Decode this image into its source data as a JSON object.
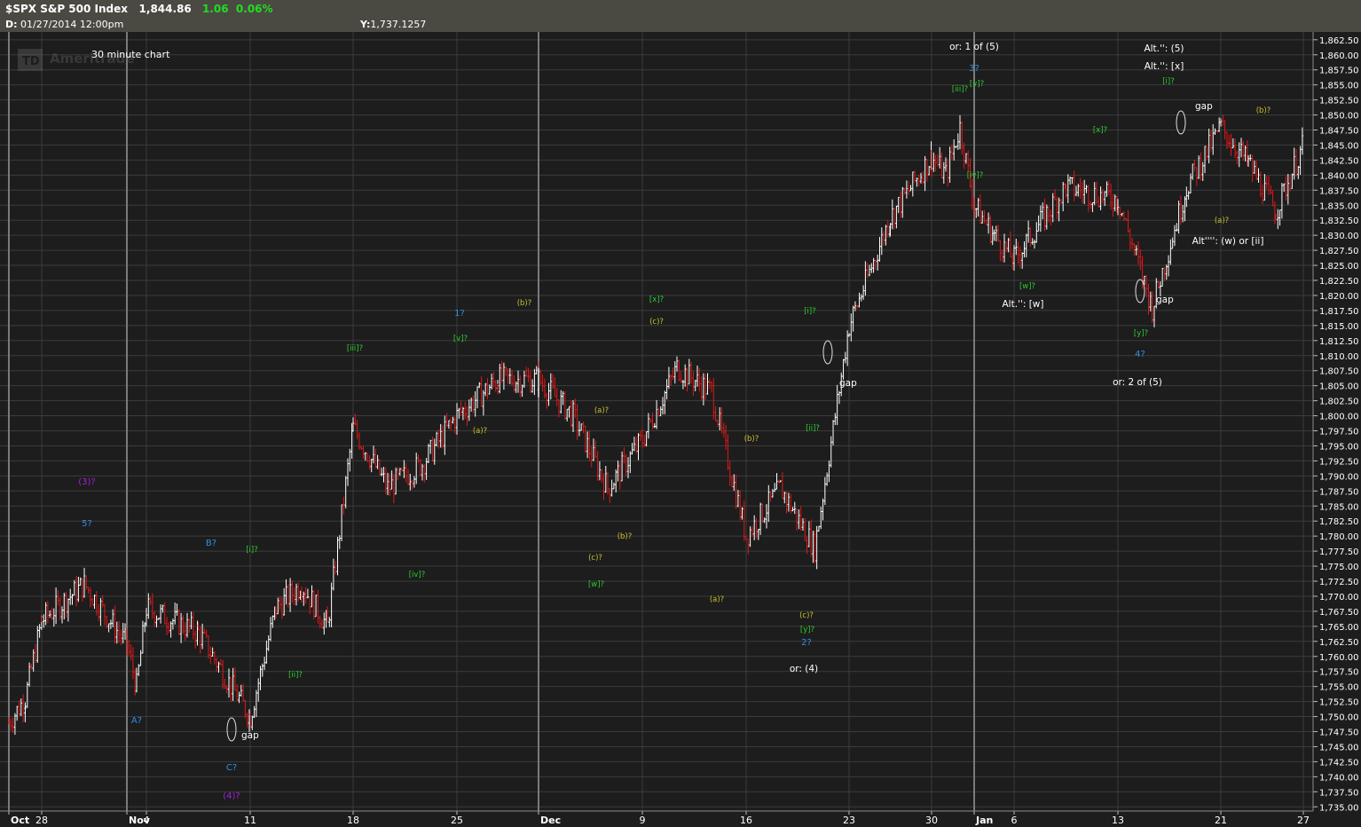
{
  "header": {
    "symbol": "$SPX S&P 500 Index",
    "last": "1,844.86",
    "change": "1.06",
    "change_pct": "0.06%",
    "date_label": "D:",
    "date_value": "01/27/2014  12:00pm",
    "y_label": "Y:",
    "y_value": "1,737.1257"
  },
  "logo_text": "Ameritrade",
  "logo_mark": "TD",
  "interval_label": "30 minute chart",
  "colors": {
    "background": "#1d1d1d",
    "header": "#4a4a42",
    "grid": "#3c3c3c",
    "up_bar": "#ffffff",
    "down_bar": "#e01818",
    "wave_blue": "#2f8fe6",
    "wave_green": "#2fcc2f",
    "wave_yellow": "#c8c030",
    "wave_purple": "#a020e0",
    "note_white": "#ffffff"
  },
  "chart_data": {
    "type": "ohlc",
    "title": "$SPX S&P 500 Index",
    "interval": "30 minute",
    "ylim": [
      1735,
      1863
    ],
    "y_ticks": [
      1735,
      1737.5,
      1740,
      1742.5,
      1745,
      1747.5,
      1750,
      1752.5,
      1755,
      1757.5,
      1760,
      1762.5,
      1765,
      1767.5,
      1770,
      1772.5,
      1775,
      1777.5,
      1780,
      1782.5,
      1785,
      1787.5,
      1790,
      1792.5,
      1795,
      1797.5,
      1800,
      1802.5,
      1805,
      1807.5,
      1810,
      1812.5,
      1815,
      1817.5,
      1820,
      1822.5,
      1825,
      1827.5,
      1830,
      1832.5,
      1835,
      1837.5,
      1840,
      1842.5,
      1845,
      1847.5,
      1850,
      1852.5,
      1855,
      1857.5,
      1860,
      1862.5
    ],
    "x_ticks": [
      "Oct",
      "28",
      "Nov",
      "4",
      "11",
      "18",
      "25",
      "Dec",
      "9",
      "16",
      "23",
      "30",
      "Jan",
      "6",
      "13",
      "21",
      "27"
    ],
    "path": [
      [
        "Oct",
        1749
      ],
      [
        "Oct",
        1753
      ],
      [
        "28",
        1766
      ],
      [
        "28",
        1772
      ],
      [
        "Nov",
        1762
      ],
      [
        "Nov",
        1755
      ],
      [
        "4",
        1768
      ],
      [
        "4",
        1764
      ],
      [
        "11",
        1750
      ],
      [
        "11",
        1768
      ],
      [
        "11",
        1772
      ],
      [
        "11",
        1765
      ],
      [
        "18",
        1798
      ],
      [
        "18",
        1788
      ],
      [
        "18",
        1792
      ],
      [
        "25",
        1800
      ],
      [
        "25",
        1806
      ],
      [
        "Dec",
        1806
      ],
      [
        "Dec",
        1800
      ],
      [
        "Dec",
        1788
      ],
      [
        "9",
        1796
      ],
      [
        "9",
        1808
      ],
      [
        "9",
        1804
      ],
      [
        "16",
        1780
      ],
      [
        "16",
        1788
      ],
      [
        "16",
        1778
      ],
      [
        "23",
        1815
      ],
      [
        "23",
        1833
      ],
      [
        "30",
        1843
      ],
      [
        "30",
        1840
      ],
      [
        "30",
        1848
      ],
      [
        "Jan",
        1835
      ],
      [
        "Jan",
        1830
      ],
      [
        "6",
        1826
      ],
      [
        "6",
        1838
      ],
      [
        "13",
        1836
      ],
      [
        "13",
        1818
      ],
      [
        "13",
        1838
      ],
      [
        "21",
        1848
      ],
      [
        "21",
        1842
      ],
      [
        "21",
        1834
      ],
      [
        "27",
        1845
      ]
    ],
    "annotations": [
      {
        "text": "(3)?",
        "color": "purple"
      },
      {
        "text": "5?",
        "color": "blue"
      },
      {
        "text": "A?",
        "color": "blue"
      },
      {
        "text": "B?",
        "color": "blue"
      },
      {
        "text": "C?",
        "color": "blue"
      },
      {
        "text": "(4)?",
        "color": "purple"
      },
      {
        "text": "gap",
        "color": "white"
      },
      {
        "text": "[i]?",
        "color": "green"
      },
      {
        "text": "[ii]?",
        "color": "green"
      },
      {
        "text": "[iii]?",
        "color": "green"
      },
      {
        "text": "[iv]?",
        "color": "green"
      },
      {
        "text": "[v]?",
        "color": "green"
      },
      {
        "text": "1?",
        "color": "blue"
      },
      {
        "text": "(a)?",
        "color": "yellow"
      },
      {
        "text": "(b)?",
        "color": "yellow"
      },
      {
        "text": "(a)?",
        "color": "yellow"
      },
      {
        "text": "(b)?",
        "color": "yellow"
      },
      {
        "text": "(c)?",
        "color": "yellow"
      },
      {
        "text": "[w]?",
        "color": "green"
      },
      {
        "text": "[x]?",
        "color": "green"
      },
      {
        "text": "(c)?",
        "color": "yellow"
      },
      {
        "text": "(b)?",
        "color": "yellow"
      },
      {
        "text": "(a)?",
        "color": "yellow"
      },
      {
        "text": "(c)?",
        "color": "yellow"
      },
      {
        "text": "[y]?",
        "color": "green"
      },
      {
        "text": "2?",
        "color": "blue"
      },
      {
        "text": "or: (4)",
        "color": "white"
      },
      {
        "text": "[i]?",
        "color": "green"
      },
      {
        "text": "[ii]?",
        "color": "green"
      },
      {
        "text": "gap",
        "color": "white"
      },
      {
        "text": "or: 1 of (5)",
        "color": "white"
      },
      {
        "text": "3?",
        "color": "blue"
      },
      {
        "text": "[iii]?",
        "color": "green"
      },
      {
        "text": "[v]?",
        "color": "green"
      },
      {
        "text": "[iv]?",
        "color": "green"
      },
      {
        "text": "[w]?",
        "color": "green"
      },
      {
        "text": "Alt.'': [w]",
        "color": "white"
      },
      {
        "text": "[x]?",
        "color": "green"
      },
      {
        "text": "gap",
        "color": "white"
      },
      {
        "text": "[y]?",
        "color": "green"
      },
      {
        "text": "4?",
        "color": "blue"
      },
      {
        "text": "or: 2 of (5)",
        "color": "white"
      },
      {
        "text": "Alt.'': (5)",
        "color": "white"
      },
      {
        "text": "Alt.'': [x]",
        "color": "white"
      },
      {
        "text": "[i]?",
        "color": "green"
      },
      {
        "text": "gap",
        "color": "white"
      },
      {
        "text": "(b)?",
        "color": "yellow"
      },
      {
        "text": "(a)?",
        "color": "yellow"
      },
      {
        "text": "Alt'''': (w) or [ii]",
        "color": "white"
      }
    ]
  }
}
